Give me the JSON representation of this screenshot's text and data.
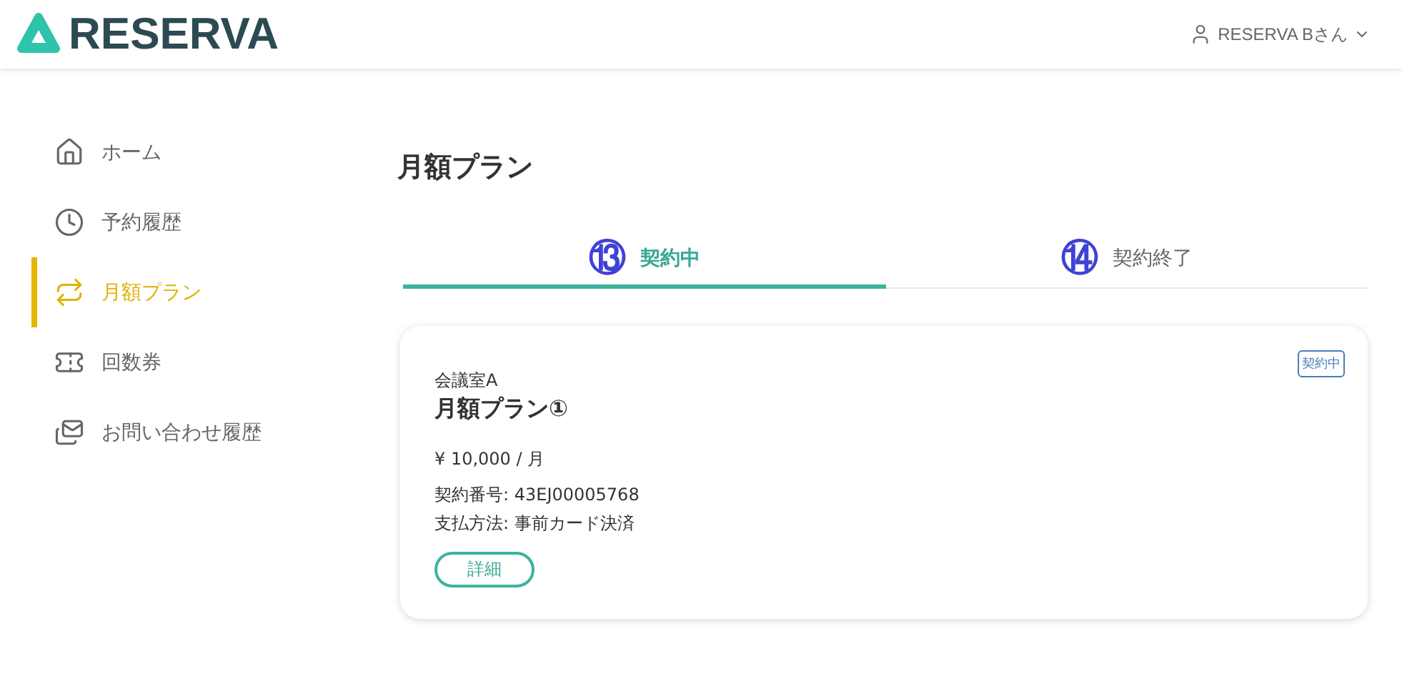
{
  "header": {
    "logo": "RESERVA",
    "user": "RESERVA Bさん"
  },
  "sidebar": {
    "items": [
      {
        "kind": "home",
        "label": "ホーム",
        "selected": false
      },
      {
        "kind": "history",
        "label": "予約履歴",
        "selected": false
      },
      {
        "kind": "plan",
        "label": "月額プラン",
        "selected": true
      },
      {
        "kind": "ticket",
        "label": "回数券",
        "selected": false
      },
      {
        "kind": "mail",
        "label": "お問い合わせ履歴",
        "selected": false
      }
    ]
  },
  "page_title": "月額プラン",
  "tabs": [
    {
      "marker": "⑬",
      "label": "契約中",
      "selected": true
    },
    {
      "marker": "⑭",
      "label": "契約終了",
      "selected": false
    }
  ],
  "plans": [
    {
      "room": "会議室A",
      "name": "月額プラン①",
      "status": "契約中",
      "price": "¥ 10,000 / 月",
      "contract": "契約番号: 43EJ00005768",
      "payment": "支払方法: 事前カード決済",
      "button": "詳細"
    }
  ]
}
